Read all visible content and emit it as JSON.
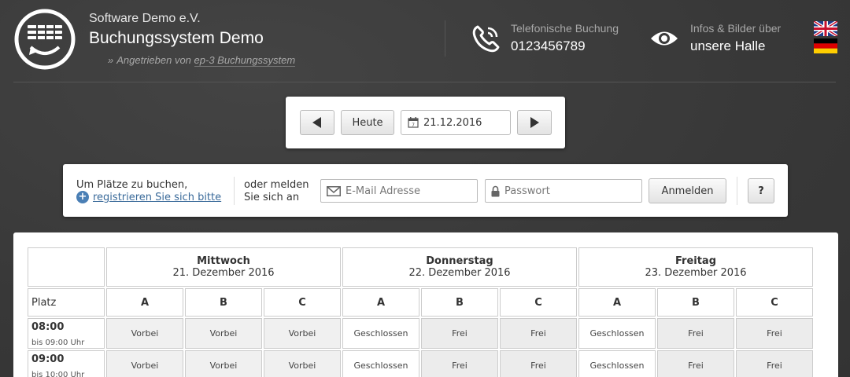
{
  "header": {
    "org": "Software Demo e.V.",
    "title": "Buchungssystem Demo",
    "powered_prefix": "»",
    "powered_text": "Angetrieben von",
    "powered_link": "ep-3 Buchungssystem",
    "phone_label": "Telefonische Buchung",
    "phone_number": "0123456789",
    "info_label": "Infos & Bilder über",
    "info_value": "unsere Halle",
    "icons": [
      "logo-icon",
      "phone-icon",
      "eye-icon",
      "flag-en-icon",
      "flag-de-icon"
    ]
  },
  "date_nav": {
    "today_label": "Heute",
    "date_value": "21.12.2016",
    "prev_icon": "triangle-left",
    "next_icon": "triangle-right"
  },
  "login": {
    "text1": "Um Plätze zu buchen,",
    "register_label": "registrieren Sie sich bitte",
    "text2_line1": "oder melden",
    "text2_line2": "Sie sich an",
    "email_placeholder": "E-Mail Adresse",
    "password_placeholder": "Passwort",
    "login_button": "Anmelden",
    "help_button": "?"
  },
  "calendar": {
    "platz_label": "Platz",
    "days": [
      {
        "name": "Mittwoch",
        "date": "21. Dezember 2016"
      },
      {
        "name": "Donnerstag",
        "date": "22. Dezember 2016"
      },
      {
        "name": "Freitag",
        "date": "23. Dezember 2016"
      }
    ],
    "courts": [
      "A",
      "B",
      "C",
      "A",
      "B",
      "C",
      "A",
      "B",
      "C"
    ],
    "rows": [
      {
        "time": "08:00",
        "until": "bis 09:00 Uhr",
        "slots": [
          "Vorbei",
          "Vorbei",
          "Vorbei",
          "Geschlossen",
          "Frei",
          "Frei",
          "Geschlossen",
          "Frei",
          "Frei"
        ]
      },
      {
        "time": "09:00",
        "until": "bis 10:00 Uhr",
        "slots": [
          "Vorbei",
          "Vorbei",
          "Vorbei",
          "Geschlossen",
          "Frei",
          "Frei",
          "Geschlossen",
          "Frei",
          "Frei"
        ]
      }
    ]
  },
  "colors": {
    "background": "#3a3a3a",
    "link": "#3a6a9a",
    "slot_past": "#f0f0f0",
    "slot_free": "#ececec"
  }
}
